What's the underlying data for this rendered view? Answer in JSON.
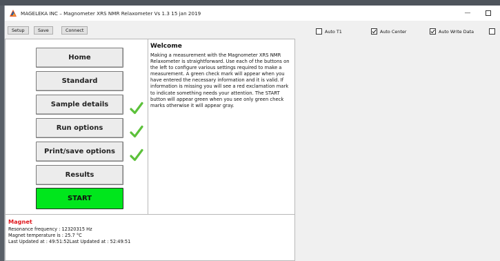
{
  "window": {
    "title": "MAGELEKA INC – Magnometer XRS NMR Relaxometer Vs 1.3 15 jan 2019",
    "minimize_glyph": "—"
  },
  "toolbar": {
    "setup_label": "Setup",
    "save_label": "Save",
    "connect_label": "Connect",
    "checkboxes": [
      {
        "label": "Auto T1",
        "checked": false
      },
      {
        "label": "Auto Center",
        "checked": true
      },
      {
        "label": "Auto Write Data",
        "checked": true
      },
      {
        "label": "",
        "checked": false
      }
    ]
  },
  "nav": {
    "home": "Home",
    "standard": "Standard",
    "sample_details": "Sample details",
    "run_options": "Run options",
    "print_save_options": "Print/save options",
    "results": "Results",
    "start": "START"
  },
  "status_checks": {
    "sample_details": "green-check-icon",
    "run_options": "green-check-icon",
    "print_save_options": "green-check-icon"
  },
  "welcome": {
    "title": "Welcome",
    "body": "Making a measurement with the Magnometer XRS NMR Relaxometer is straightforward. Use each of the buttons on the left to configure various settings required to make a measurement. A green check mark will appear when you have entered the necessary information and it is valid. If information is missing you will see a red exclamation mark to indicate something needs your attention. The START button will appear green when you see only green check marks otherwise it will appear gray."
  },
  "magnet": {
    "title": "Magnet",
    "resonance": "Resonance frequency : 12320315 Hz",
    "temperature": "Magnet temperature is : 25.7 °C",
    "last_updated": "Last Updated at : 49:51:52Last Updated at : 52:49:51"
  },
  "colors": {
    "start_button": "#00e61c",
    "check_green": "#5cc13a",
    "magnet_title": "#e0191f"
  }
}
